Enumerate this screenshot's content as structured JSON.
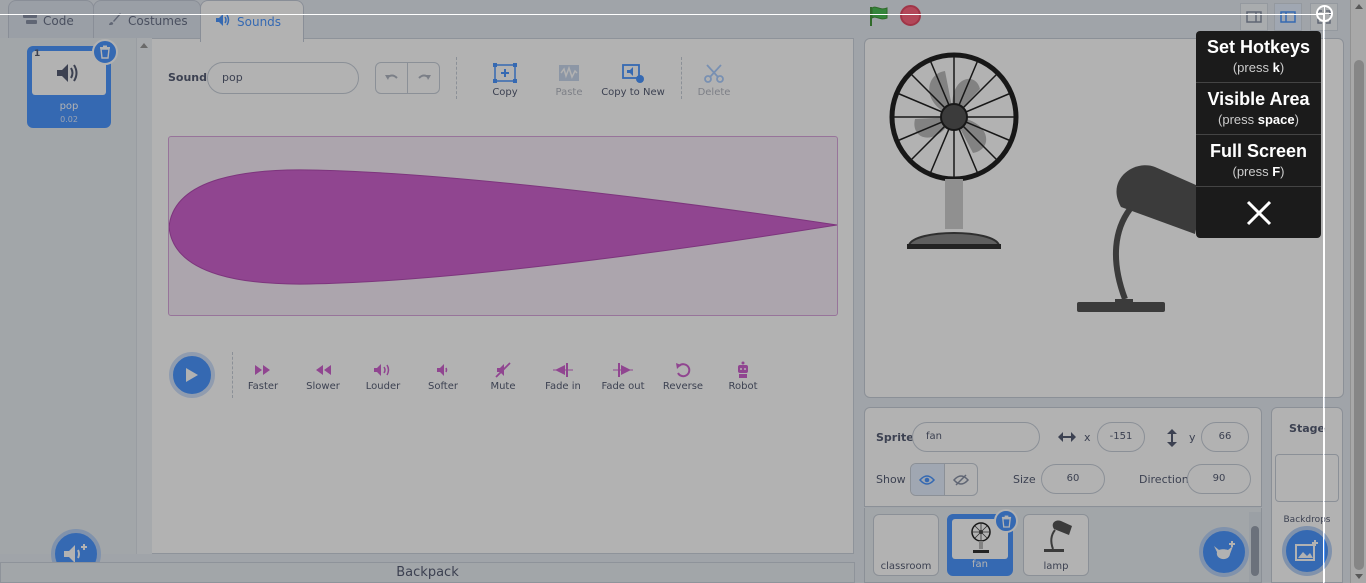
{
  "tabs": [
    {
      "label": "Code",
      "icon": "code-icon"
    },
    {
      "label": "Costumes",
      "icon": "brush-icon"
    },
    {
      "label": "Sounds",
      "icon": "speaker-icon"
    }
  ],
  "sound_list": {
    "items": [
      {
        "number": "1",
        "name": "pop",
        "duration": "0.02"
      }
    ]
  },
  "editor": {
    "sound_label": "Sound",
    "sound_name": "pop",
    "tools": {
      "copy": "Copy",
      "paste": "Paste",
      "copy_to_new": "Copy to New",
      "delete": "Delete"
    },
    "effects": [
      "Faster",
      "Slower",
      "Louder",
      "Softer",
      "Mute",
      "Fade in",
      "Fade out",
      "Reverse",
      "Robot"
    ],
    "wave_color": "#cf63cf"
  },
  "backpack": {
    "label": "Backpack"
  },
  "sprite_info": {
    "sprite_label": "Sprite",
    "sprite_name": "fan",
    "x_label": "x",
    "x_value": "-151",
    "y_label": "y",
    "y_value": "66",
    "show_label": "Show",
    "size_label": "Size",
    "size_value": "60",
    "direction_label": "Direction",
    "direction_value": "90"
  },
  "sprites": [
    {
      "name": "classroom",
      "selected": false
    },
    {
      "name": "fan",
      "selected": true
    },
    {
      "name": "lamp",
      "selected": false
    }
  ],
  "stage_pane": {
    "title": "Stage",
    "backdrops_label": "Backdrops"
  },
  "menu": {
    "items": [
      {
        "title": "Set Hotkeys",
        "hint_pre": "(press ",
        "key": "k",
        "hint_post": ")"
      },
      {
        "title": "Visible Area",
        "hint_pre": "(press ",
        "key": "space",
        "hint_post": ")"
      },
      {
        "title": "Full Screen",
        "hint_pre": "(press ",
        "key": "F",
        "hint_post": ")"
      }
    ]
  },
  "colors": {
    "accent": "#4c97ff",
    "sound_pink": "#cf63cf",
    "flag_green": "#4cbf56",
    "stop_red": "#ff6680"
  }
}
